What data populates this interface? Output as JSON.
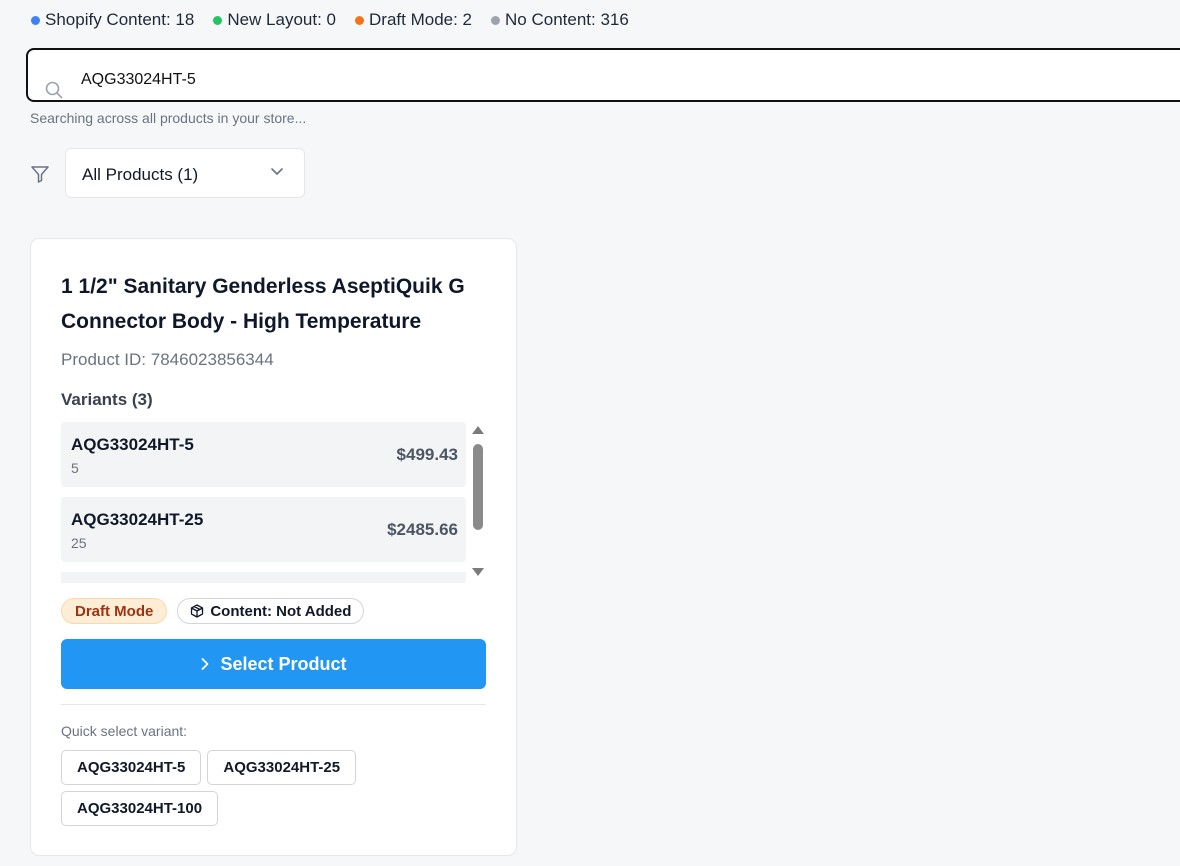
{
  "legend": [
    {
      "label": "Shopify Content: 18",
      "color": "#3b82f6"
    },
    {
      "label": "New Layout: 0",
      "color": "#22c55e"
    },
    {
      "label": "Draft Mode: 2",
      "color": "#f97316"
    },
    {
      "label": "No Content: 316",
      "color": "#9ca3af"
    }
  ],
  "search": {
    "value": "AQG33024HT-5",
    "hint": "Searching across all products in your store..."
  },
  "filter": {
    "selected": "All Products (1)"
  },
  "product": {
    "title": "1 1/2\" Sanitary Genderless AseptiQuik G Connector Body - High Temperature",
    "id_text": "Product ID: 7846023856344",
    "variants_heading": "Variants (3)",
    "variants": [
      {
        "sku": "AQG33024HT-5",
        "qty": "5",
        "price": "$499.43"
      },
      {
        "sku": "AQG33024HT-25",
        "qty": "25",
        "price": "$2485.66"
      }
    ],
    "badges": {
      "draft": "Draft Mode",
      "content": "Content: Not Added"
    },
    "select_button": "Select Product",
    "quick_label": "Quick select variant:",
    "quick_variants": [
      "AQG33024HT-5",
      "AQG33024HT-25",
      "AQG33024HT-100"
    ]
  }
}
